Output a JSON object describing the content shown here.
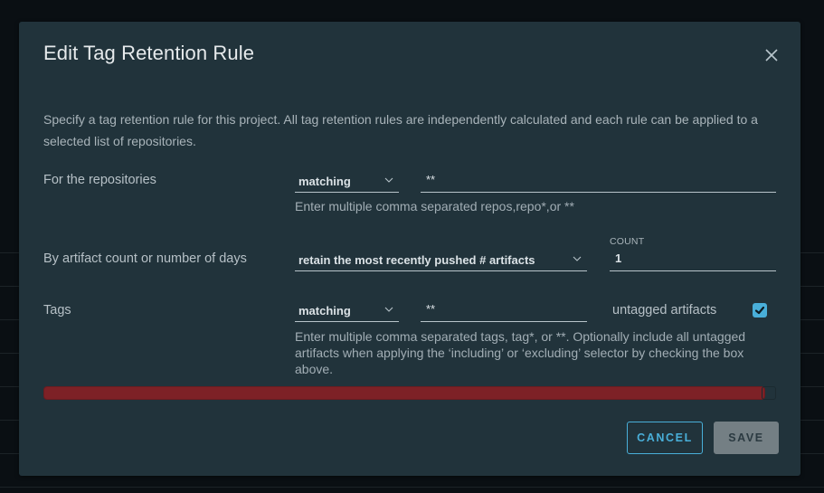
{
  "dialog": {
    "title": "Edit Tag Retention Rule",
    "close_icon": "close-icon",
    "description": "Specify a tag retention rule for this project. All tag retention rules are independently calculated and each rule can be applied to a selected list of repositories."
  },
  "repositories": {
    "label": "For the repositories",
    "selector": "matching",
    "value": "**",
    "helper": "Enter multiple comma separated repos,repo*,or **"
  },
  "retention": {
    "label": "By artifact count or number of days",
    "selector": "retain the most recently pushed # artifacts",
    "count_label": "COUNT",
    "count_value": "1"
  },
  "tags": {
    "label": "Tags",
    "selector": "matching",
    "value": "**",
    "untagged_label": "untagged artifacts",
    "untagged_checked": true,
    "helper": "Enter multiple comma separated tags, tag*, or **. Optionally include all untagged artifacts when applying the ‘including’ or ‘excluding’ selector by checking the box above."
  },
  "alert": {
    "type": "error",
    "text": ""
  },
  "footer": {
    "cancel_label": "CANCEL",
    "save_label": "SAVE",
    "save_disabled": true
  },
  "colors": {
    "accent": "#49afd9",
    "modal_bg": "#21333b",
    "error": "#7d2126",
    "disabled_button": "#747f84"
  }
}
